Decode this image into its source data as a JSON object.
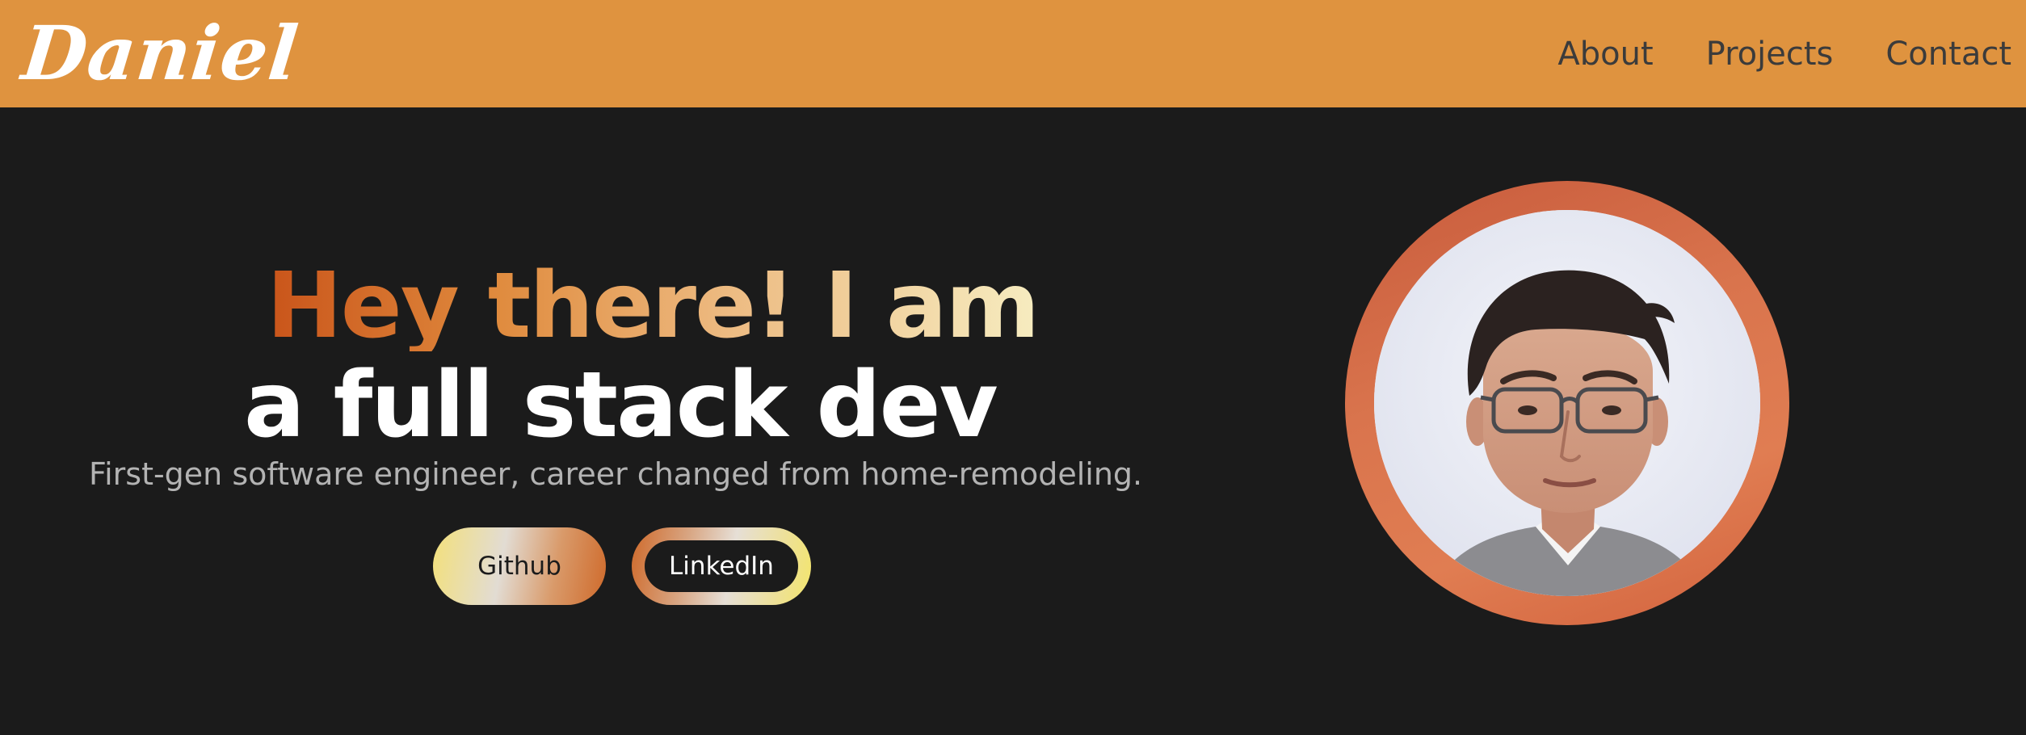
{
  "navbar": {
    "logo": "Daniel",
    "links": [
      {
        "label": "About"
      },
      {
        "label": "Projects"
      },
      {
        "label": "Contact"
      }
    ],
    "background_color": "#df933f"
  },
  "hero": {
    "headline_line1": "Hey there! I am",
    "headline_line2": "a full stack dev",
    "subtitle": "First-gen software engineer, career changed from home-remodeling.",
    "buttons": {
      "github_label": "Github",
      "linkedin_label": "LinkedIn"
    },
    "background_color": "#1b1b1b",
    "accent_gradient": [
      "#c9541a",
      "#e08b3e",
      "#edbb82",
      "#f6ecc0"
    ]
  },
  "avatar": {
    "ring_color": "#d9744d"
  }
}
